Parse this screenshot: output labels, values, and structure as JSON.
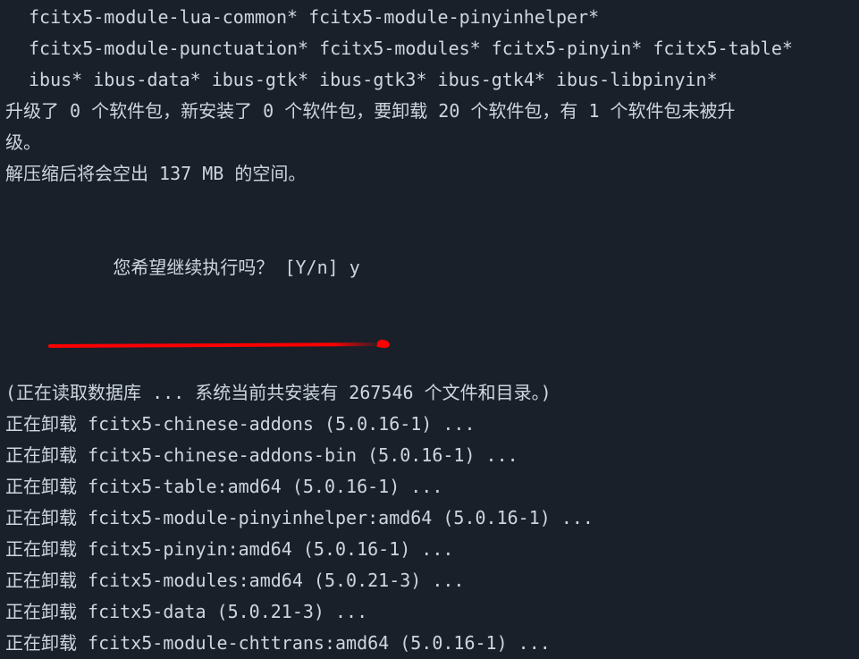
{
  "package_list_1": "fcitx5-module-lua-common* fcitx5-module-pinyinhelper*",
  "package_list_2": "fcitx5-module-punctuation* fcitx5-modules* fcitx5-pinyin* fcitx5-table*",
  "package_list_3": "ibus* ibus-data* ibus-gtk* ibus-gtk3* ibus-gtk4* ibus-libpinyin*",
  "upgrade_summary_1": "升级了 0 个软件包，新安装了 0 个软件包，要卸载 20 个软件包，有 1 个软件包未被升",
  "upgrade_summary_2": "级。",
  "space_freed": "解压缩后将会空出 137 MB 的空间。",
  "prompt_question": "您希望继续执行吗？ [Y/n] ",
  "user_input": "y",
  "reading_db": "(正在读取数据库 ... 系统当前共安装有 267546 个文件和目录。)",
  "removing": [
    "正在卸载 fcitx5-chinese-addons (5.0.16-1) ...",
    "正在卸载 fcitx5-chinese-addons-bin (5.0.16-1) ...",
    "正在卸载 fcitx5-table:amd64 (5.0.16-1) ...",
    "正在卸载 fcitx5-module-pinyinhelper:amd64 (5.0.16-1) ...",
    "正在卸载 fcitx5-pinyin:amd64 (5.0.16-1) ...",
    "正在卸载 fcitx5-modules:amd64 (5.0.21-3) ...",
    "正在卸载 fcitx5-data (5.0.21-3) ...",
    "正在卸载 fcitx5-module-chttrans:amd64 (5.0.16-1) ..."
  ]
}
